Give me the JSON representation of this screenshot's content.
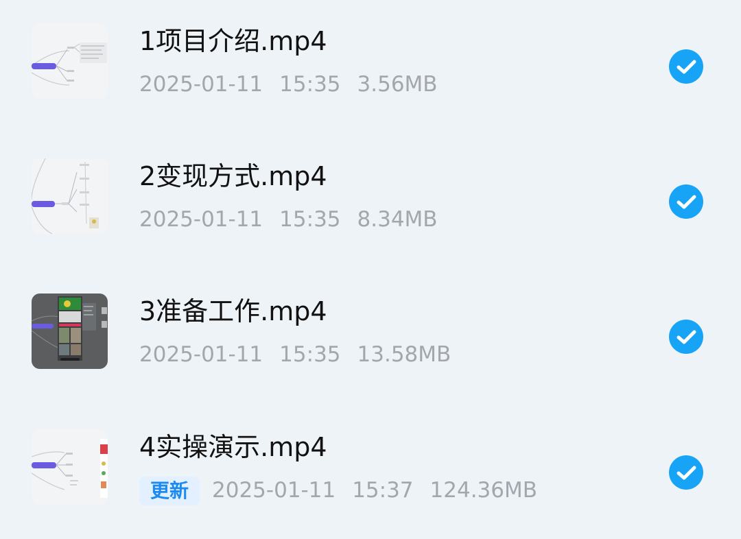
{
  "colors": {
    "background": "#eef3f8",
    "check_blue": "#18a4f6",
    "badge_text": "#1d8af0",
    "badge_bg": "#e3f0ff",
    "meta_text": "#a3a7ad"
  },
  "files": [
    {
      "name": "1项目介绍.mp4",
      "date": "2025-01-11",
      "time": "15:35",
      "size": "3.56MB",
      "selected": true,
      "thumbnail": "mindmap-light"
    },
    {
      "name": "2变现方式.mp4",
      "date": "2025-01-11",
      "time": "15:35",
      "size": "8.34MB",
      "selected": true,
      "thumbnail": "mindmap-light"
    },
    {
      "name": "3准备工作.mp4",
      "date": "2025-01-11",
      "time": "15:35",
      "size": "13.58MB",
      "selected": true,
      "thumbnail": "mindmap-dark-phone"
    },
    {
      "name": "4实操演示.mp4",
      "badge": "更新",
      "date": "2025-01-11",
      "time": "15:37",
      "size": "124.36MB",
      "selected": true,
      "thumbnail": "mindmap-light-phone"
    }
  ],
  "icons": {
    "check": "checkmark-circle-icon"
  }
}
